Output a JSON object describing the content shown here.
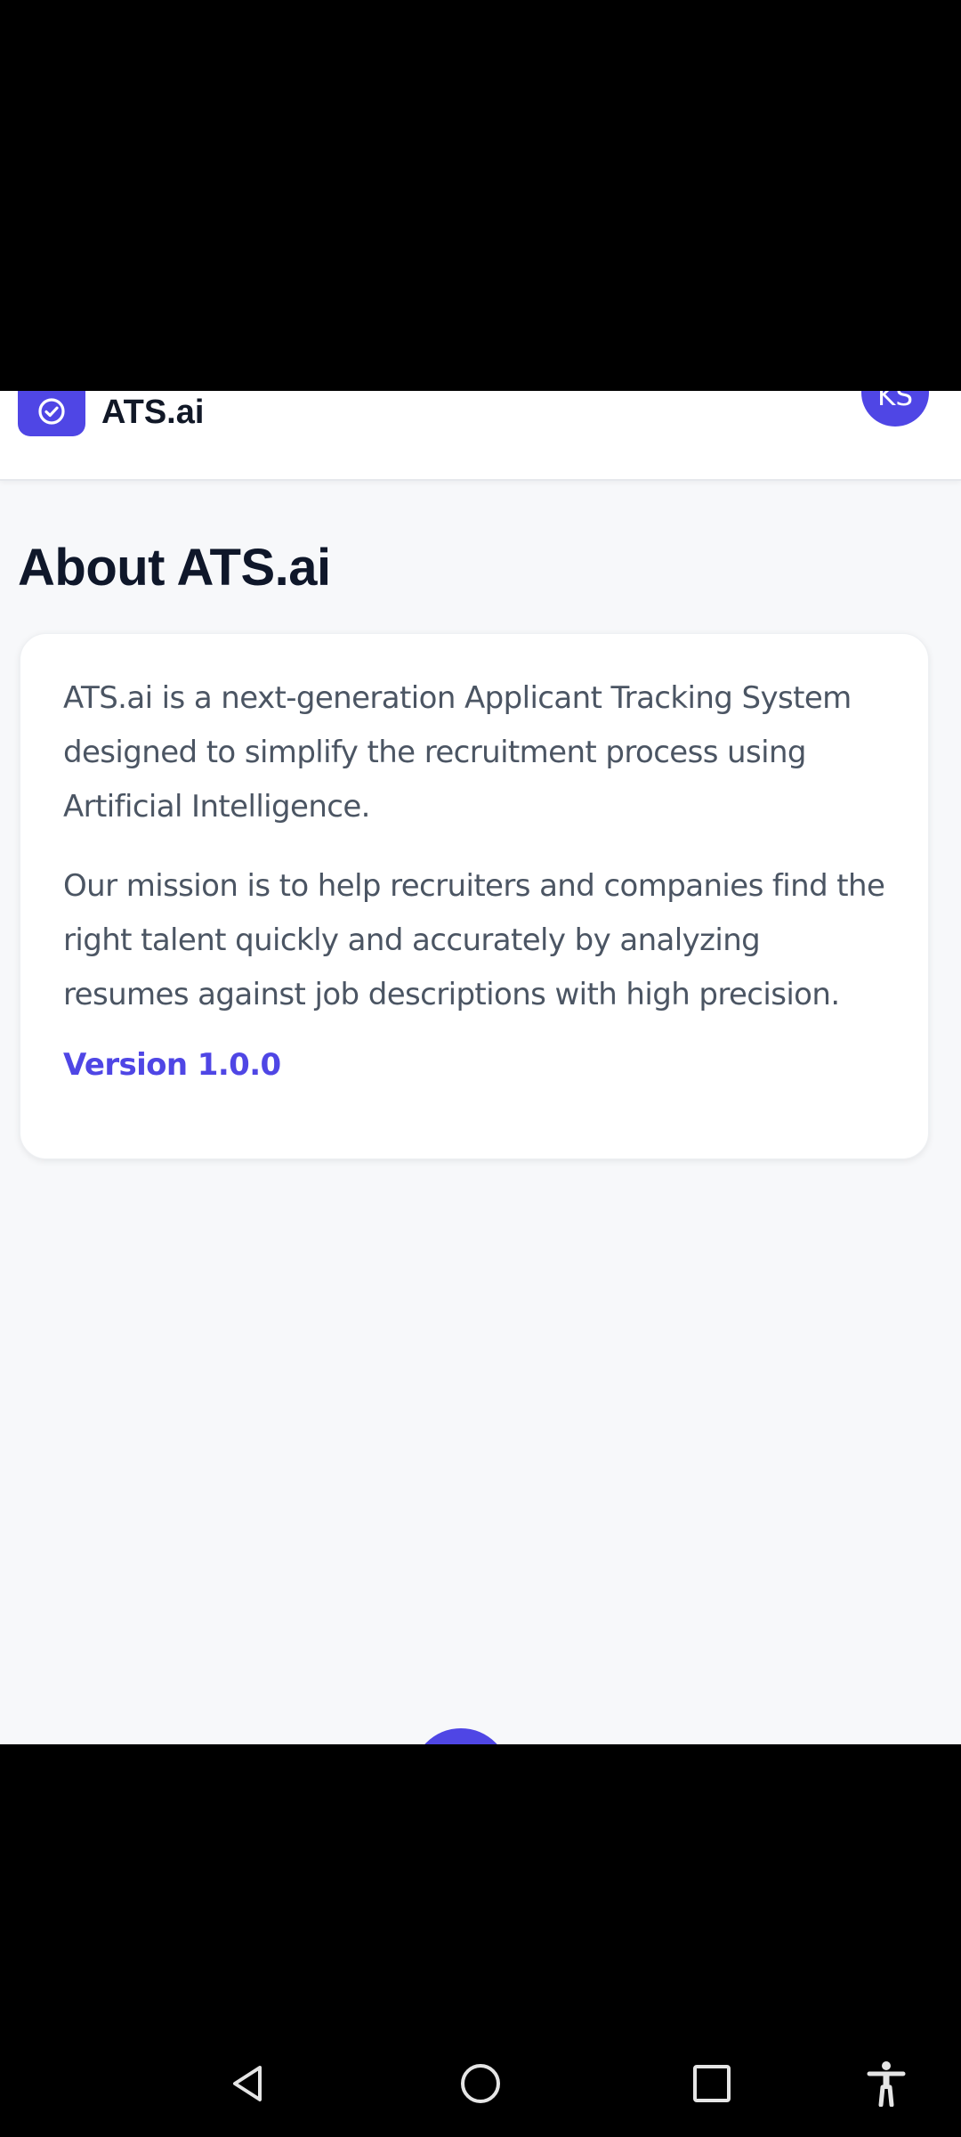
{
  "header": {
    "brand": "ATS.ai",
    "avatar_initials": "KS",
    "logo_icon": "check-circle-icon"
  },
  "page": {
    "title": "About ATS.ai"
  },
  "about_card": {
    "paragraph_1": "ATS.ai is a next-generation Applicant Tracking System designed to simplify the recruitment process using Artificial Intelligence.",
    "paragraph_2": "Our mission is to help recruiters and companies find the right talent quickly and accurately by analyzing resumes against job descriptions with high precision.",
    "version": "Version 1.0.0"
  },
  "system_nav": {
    "icons": [
      "back-icon",
      "home-icon",
      "recents-icon",
      "accessibility-icon"
    ]
  },
  "colors": {
    "accent": "#4f46e5",
    "background": "#f7f8fa",
    "card": "#ffffff",
    "title": "#0f172a",
    "body_text": "#4b5563"
  }
}
